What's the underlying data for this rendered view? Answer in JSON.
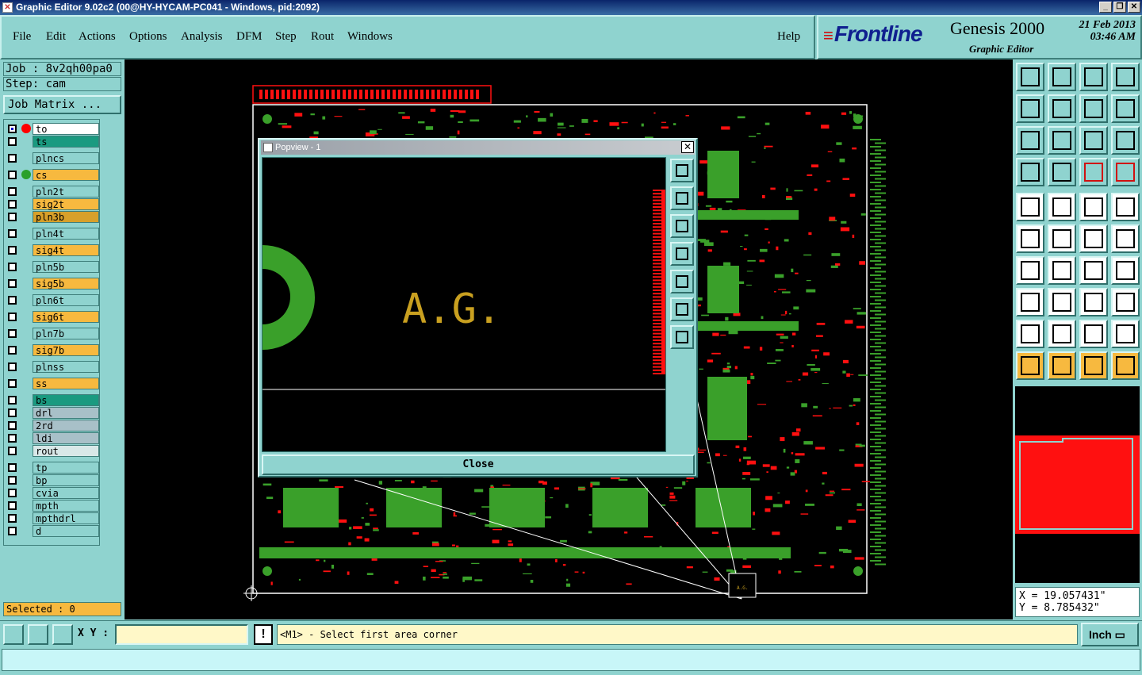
{
  "window": {
    "title": "Graphic Editor 9.02c2 (00@HY-HYCAM-PC041 - Windows, pid:2092)"
  },
  "menu": {
    "file": "File",
    "edit": "Edit",
    "actions": "Actions",
    "options": "Options",
    "analysis": "Analysis",
    "dfm": "DFM",
    "step": "Step",
    "rout": "Rout",
    "windows": "Windows",
    "help": "Help"
  },
  "brand": {
    "logo": "Frontline",
    "product": "Genesis 2000",
    "subtitle": "Graphic Editor",
    "date": "21 Feb 2013",
    "time": "03:46 AM"
  },
  "job": {
    "job_label": "Job : 8v2qh00pa0",
    "step_label": "Step: cam",
    "matrix_button": "Job Matrix ..."
  },
  "layers": [
    {
      "name": "to",
      "color": "#ffffff",
      "dot": "#ff0000",
      "checked": true
    },
    {
      "name": "ts",
      "color": "#1a9a80",
      "dot": "",
      "checked": false
    },
    {
      "name": "plncs",
      "color": "#8fd3cf",
      "dot": "",
      "checked": false
    },
    {
      "name": "cs",
      "color": "#f7b93f",
      "dot": "#2aa02a",
      "checked": false
    },
    {
      "name": "pln2t",
      "color": "#8fd3cf",
      "dot": "",
      "checked": false
    },
    {
      "name": "sig2t",
      "color": "#f7b93f",
      "dot": "",
      "checked": false
    },
    {
      "name": "pln3b",
      "color": "#d8a02a",
      "dot": "",
      "checked": false
    },
    {
      "name": "pln4t",
      "color": "#8fd3cf",
      "dot": "",
      "checked": false
    },
    {
      "name": "sig4t",
      "color": "#f7b93f",
      "dot": "",
      "checked": false
    },
    {
      "name": "pln5b",
      "color": "#8fd3cf",
      "dot": "",
      "checked": false
    },
    {
      "name": "sig5b",
      "color": "#f7b93f",
      "dot": "",
      "checked": false
    },
    {
      "name": "pln6t",
      "color": "#8fd3cf",
      "dot": "",
      "checked": false
    },
    {
      "name": "sig6t",
      "color": "#f7b93f",
      "dot": "",
      "checked": false
    },
    {
      "name": "pln7b",
      "color": "#8fd3cf",
      "dot": "",
      "checked": false
    },
    {
      "name": "sig7b",
      "color": "#f7b93f",
      "dot": "",
      "checked": false
    },
    {
      "name": "plnss",
      "color": "#8fd3cf",
      "dot": "",
      "checked": false
    },
    {
      "name": "ss",
      "color": "#f7b93f",
      "dot": "",
      "checked": false
    },
    {
      "name": "bs",
      "color": "#1a9a80",
      "dot": "",
      "checked": false
    },
    {
      "name": "drl",
      "color": "#a8c0c8",
      "dot": "",
      "checked": false
    },
    {
      "name": "2rd",
      "color": "#a8c0c8",
      "dot": "",
      "checked": false
    },
    {
      "name": "ldi",
      "color": "#a8c0c8",
      "dot": "",
      "checked": false
    },
    {
      "name": "rout",
      "color": "#d8e8e8",
      "dot": "",
      "checked": false
    },
    {
      "name": "tp",
      "color": "#8fd3cf",
      "dot": "",
      "checked": false
    },
    {
      "name": "bp",
      "color": "#8fd3cf",
      "dot": "",
      "checked": false
    },
    {
      "name": "cvia",
      "color": "#8fd3cf",
      "dot": "",
      "checked": false
    },
    {
      "name": "mpth",
      "color": "#8fd3cf",
      "dot": "",
      "checked": false
    },
    {
      "name": "mpthdrl",
      "color": "#8fd3cf",
      "dot": "",
      "checked": false
    },
    {
      "name": "d",
      "color": "#8fd3cf",
      "dot": "",
      "checked": false
    }
  ],
  "selected": "Selected : 0",
  "popview": {
    "title": "Popview - 1",
    "text": "A.G.",
    "close_label": "Close",
    "close_x": "✕"
  },
  "coords": {
    "x": "X = 19.057431\"",
    "y": "Y = 8.785432\""
  },
  "bottom": {
    "xy_label": "X Y :",
    "xy_value": "",
    "bang": "!",
    "prompt": "<M1> - Select first area corner",
    "unit": "Inch"
  },
  "colors": {
    "bg": "#8fd3cf",
    "copper": "#ff1010",
    "soldermask": "#3aa02a",
    "silk": "#c9a020",
    "layer_yellow": "#f7b93f"
  }
}
